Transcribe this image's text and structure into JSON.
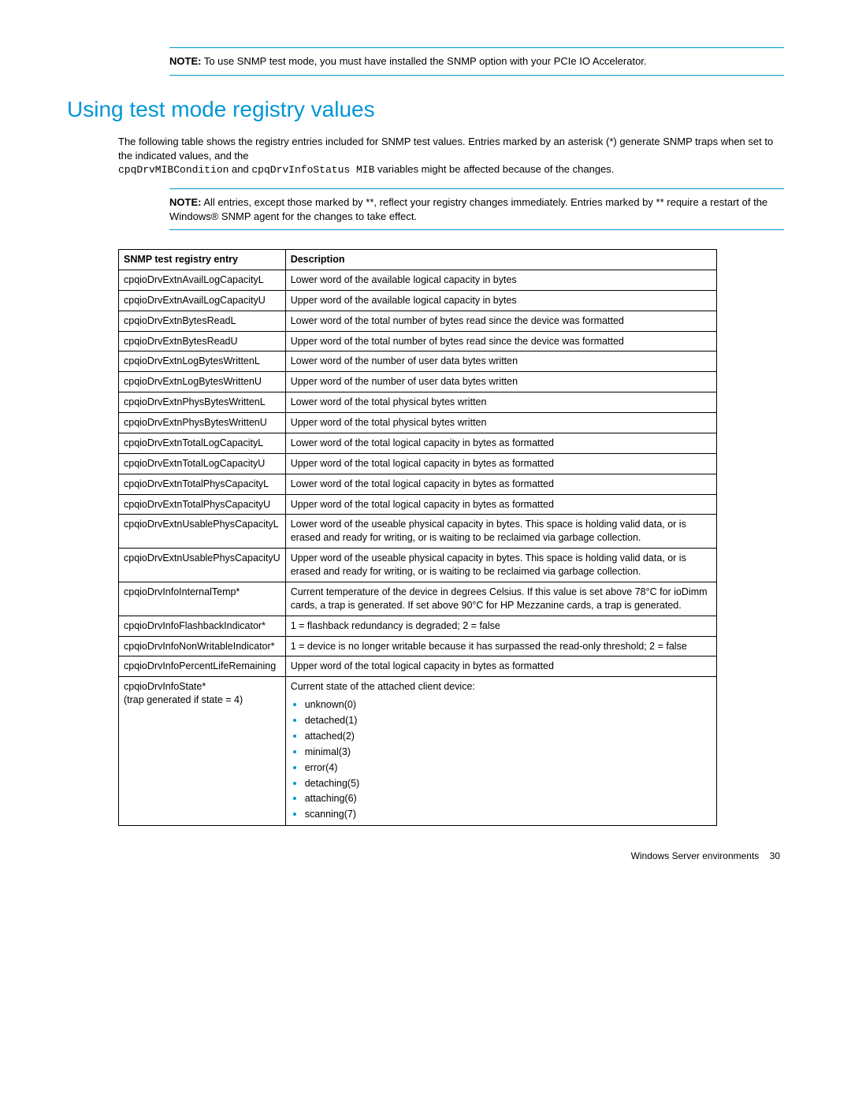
{
  "notes": {
    "label": "NOTE:",
    "top": "To use SNMP test mode, you must have installed the SNMP option with your PCIe IO Accelerator.",
    "mid": "All entries, except those marked by **, reflect your registry changes immediately. Entries marked by ** require a restart of the Windows® SNMP agent for the changes to take effect."
  },
  "heading": "Using test mode registry values",
  "intro": {
    "p1": "The following table shows the registry entries included for SNMP test values. Entries marked by an asterisk (*) generate SNMP traps when set to the indicated values, and the",
    "code1": "cpqDrvMIBCondition",
    "and": " and ",
    "code2": "cpqDrvInfoStatus MIB",
    "p2": " variables might be affected because of the changes."
  },
  "table": {
    "headers": {
      "entry": "SNMP test registry entry",
      "desc": "Description"
    },
    "rows": [
      {
        "entry": "cpqioDrvExtnAvailLogCapacityL",
        "desc": "Lower word of the available logical capacity in bytes"
      },
      {
        "entry": "cpqioDrvExtnAvailLogCapacityU",
        "desc": "Upper word of the available logical capacity in bytes"
      },
      {
        "entry": "cpqioDrvExtnBytesReadL",
        "desc": "Lower word of the total number of bytes read since the device was formatted"
      },
      {
        "entry": "cpqioDrvExtnBytesReadU",
        "desc": "Upper word of the total number of bytes read since the device was formatted"
      },
      {
        "entry": "cpqioDrvExtnLogBytesWrittenL",
        "desc": "Lower word of the number of user data bytes written"
      },
      {
        "entry": "cpqioDrvExtnLogBytesWrittenU",
        "desc": "Upper word of the number of user data bytes written"
      },
      {
        "entry": "cpqioDrvExtnPhysBytesWrittenL",
        "desc": "Lower word of the total physical bytes written"
      },
      {
        "entry": "cpqioDrvExtnPhysBytesWrittenU",
        "desc": "Upper word of the total physical bytes written"
      },
      {
        "entry": "cpqioDrvExtnTotalLogCapacityL",
        "desc": "Lower word of the total logical capacity in bytes as formatted"
      },
      {
        "entry": "cpqioDrvExtnTotalLogCapacityU",
        "desc": "Upper word of the total logical capacity in bytes as formatted"
      },
      {
        "entry": "cpqioDrvExtnTotalPhysCapacityL",
        "desc": "Lower word of the total logical capacity in bytes as formatted"
      },
      {
        "entry": "cpqioDrvExtnTotalPhysCapacityU",
        "desc": "Upper word of the total logical capacity in bytes as formatted"
      },
      {
        "entry": "cpqioDrvExtnUsablePhysCapacityL",
        "desc": "Lower word of the useable physical capacity in bytes. This space is holding valid data, or is erased and ready for writing, or is waiting to be reclaimed via garbage collection."
      },
      {
        "entry": "cpqioDrvExtnUsablePhysCapacityU",
        "desc": "Upper word of the useable physical capacity in bytes. This space is holding valid data, or is erased and ready for writing, or is waiting to be reclaimed via garbage collection."
      },
      {
        "entry": "cpqioDrvInfoInternalTemp*",
        "desc": "Current temperature of the device in degrees Celsius. If this value is set above 78°C for ioDimm cards, a trap is generated. If set above 90°C for HP Mezzanine cards, a trap is generated."
      },
      {
        "entry": "cpqioDrvInfoFlashbackIndicator*",
        "desc": "1 = flashback redundancy is degraded; 2 = false"
      },
      {
        "entry": "cpqioDrvInfoNonWritableIndicator*",
        "desc": "1 = device is no longer writable because it has surpassed the read-only threshold; 2 = false"
      },
      {
        "entry": "cpqioDrvInfoPercentLifeRemaining",
        "desc": "Upper word of the total logical capacity in bytes as formatted"
      }
    ],
    "stateRow": {
      "entry1": "cpqioDrvInfoState*",
      "entry2": "(trap generated if state = 4)",
      "lead": "Current state of the attached client device:",
      "items": [
        "unknown(0)",
        "detached(1)",
        "attached(2)",
        "minimal(3)",
        "error(4)",
        "detaching(5)",
        "attaching(6)",
        "scanning(7)"
      ]
    }
  },
  "footer": {
    "text": "Windows Server environments",
    "page": "30"
  }
}
